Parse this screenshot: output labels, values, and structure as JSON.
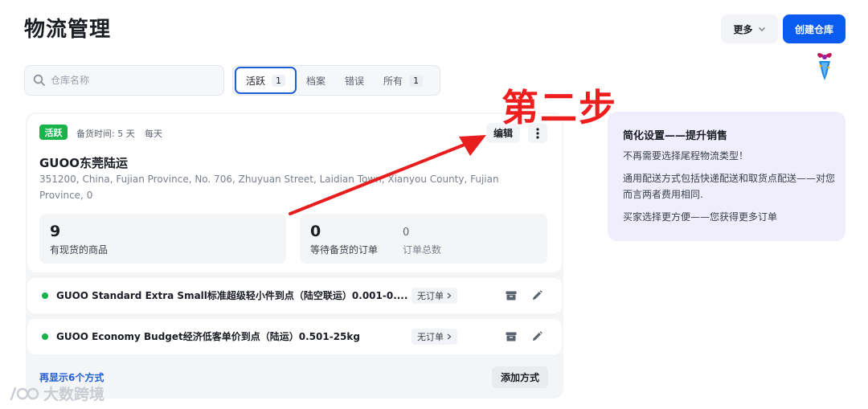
{
  "header": {
    "title": "物流管理",
    "more_label": "更多",
    "create_label": "创建仓库"
  },
  "search": {
    "placeholder": "仓库名称",
    "value": ""
  },
  "tabs": [
    {
      "label": "活跃",
      "count": "1",
      "active": true
    },
    {
      "label": "档案",
      "count": "",
      "active": false
    },
    {
      "label": "错误",
      "count": "",
      "active": false
    },
    {
      "label": "所有",
      "count": "1",
      "active": false
    }
  ],
  "warehouse": {
    "status": "活跃",
    "prep_time": "备货时间: 5 天",
    "schedule": "每天",
    "edit_label": "编辑",
    "name": "GUOO东莞陆运",
    "address": "351200, China, Fujian Province, No. 706, Zhuyuan Street, Laidian Town, Xianyou County, Fujian Province, 0",
    "stats": {
      "in_stock": {
        "value": "9",
        "label": "有现货的商品"
      },
      "pending_orders": {
        "value": "0",
        "label": "等待备货的订单"
      },
      "total_orders": {
        "value": "0",
        "label": "订单总数"
      }
    }
  },
  "methods": [
    {
      "name": "GUOO Standard Extra Small标准超级轻小件到点（陆空联运）0.001-0....",
      "status": "无订单"
    },
    {
      "name": "GUOO Economy Budget经济低客单价到点（陆运）0.501-25kg",
      "status": "无订单"
    }
  ],
  "footer": {
    "show_more": "再显示6个方式",
    "add_method": "添加方式"
  },
  "promo": {
    "title": "简化设置——提升销售",
    "line1": "不再需要选择尾程物流类型！",
    "line2": "通用配送方式包括快递配送和取货点配送——对您而言两者费用相同.",
    "line3": "买家选择更方便——您获得更多订单"
  },
  "annotation": {
    "step_text": "第二步"
  },
  "watermark": {
    "text": "大数跨境"
  },
  "colors": {
    "primary": "#0a5cf0",
    "active_green": "#19b24b",
    "annotation_red": "#ee1e1e",
    "promo_bg": "#f0eefc"
  }
}
